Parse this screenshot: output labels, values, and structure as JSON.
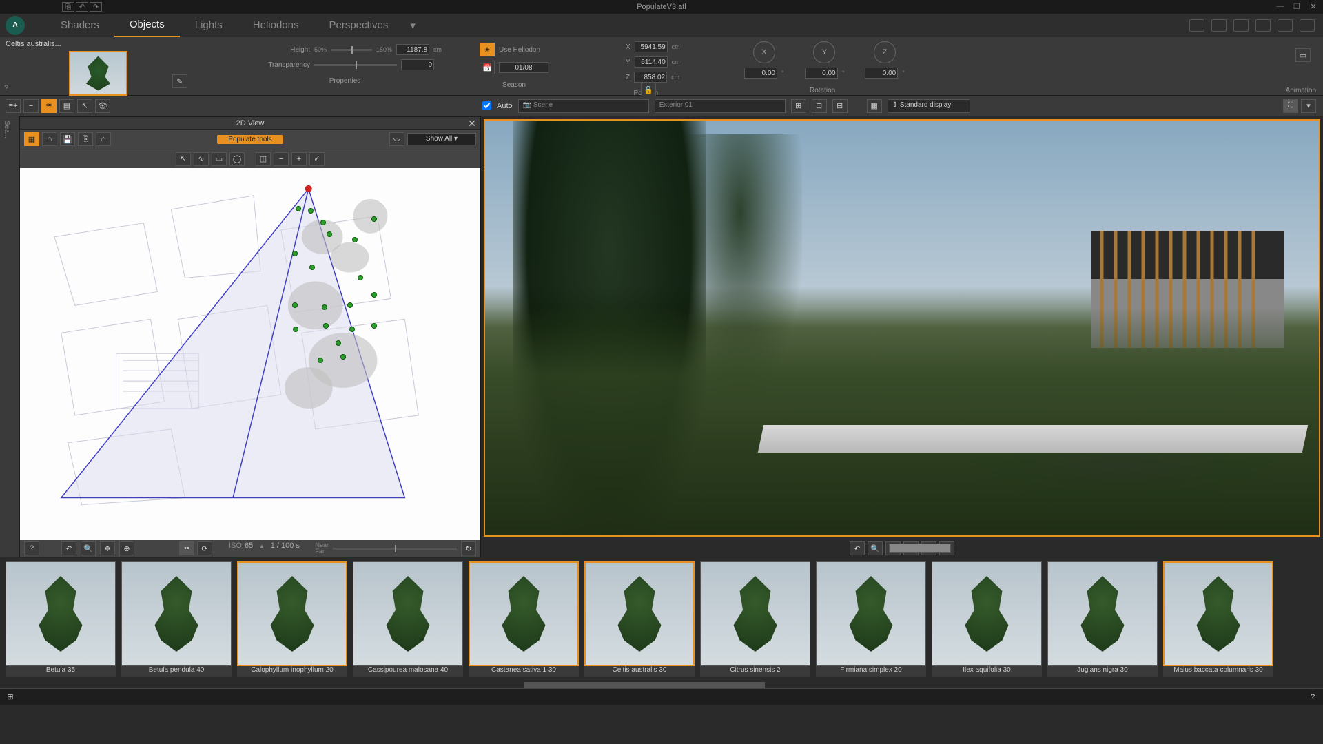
{
  "titlebar": {
    "filename": "PopulateV3.atl"
  },
  "menubar": {
    "items": [
      "Shaders",
      "Objects",
      "Lights",
      "Heliodons",
      "Perspectives"
    ],
    "active": 1
  },
  "thumbnail": {
    "label": "Celtis australis..."
  },
  "properties": {
    "height_label": "Height",
    "height_min": "50%",
    "height_max": "150%",
    "height_value": "1187.8",
    "height_unit": "cm",
    "transparency_label": "Transparency",
    "transparency_value": "0",
    "section_label": "Properties"
  },
  "season": {
    "use_heliodon": "Use Heliodon",
    "date": "01/08",
    "section_label": "Season"
  },
  "position": {
    "x_label": "X",
    "x_value": "5941.59",
    "x_unit": "cm",
    "y_label": "Y",
    "y_value": "6114.40",
    "y_unit": "cm",
    "z_label": "Z",
    "z_value": "858.02",
    "z_unit": "cm",
    "section_label": "Position"
  },
  "rotation": {
    "axes": [
      "X",
      "Y",
      "Z"
    ],
    "values": [
      "0.00",
      "0.00",
      "0.00"
    ],
    "unit": "°",
    "section_label": "Rotation"
  },
  "animation_label": "Animation",
  "toolbar": {
    "auto": "Auto",
    "scene_dd": "Scene",
    "view_dd": "Exterior 01",
    "display_mode": "Standard display"
  },
  "view2d": {
    "title": "2D View",
    "populate_label": "Populate tools",
    "showall": "Show All",
    "near": "Near",
    "far": "Far",
    "help": "?"
  },
  "render_controls": {
    "iso_label": "ISO",
    "iso_value": "65",
    "frame_label": "1 / 100 s"
  },
  "catalog": {
    "items": [
      {
        "label": "Betula 35",
        "selected": false
      },
      {
        "label": "Betula pendula 40",
        "selected": false
      },
      {
        "label": "Calophyllum inophyllum 20",
        "selected": true
      },
      {
        "label": "Cassipourea malosana 40",
        "selected": false
      },
      {
        "label": "Castanea sativa 1 30",
        "selected": true
      },
      {
        "label": "Celtis australis 30",
        "selected": true
      },
      {
        "label": "Citrus sinensis 2",
        "selected": false
      },
      {
        "label": "Firmiana simplex 20",
        "selected": false
      },
      {
        "label": "Ilex aquifolia 30",
        "selected": false
      },
      {
        "label": "Juglans nigra 30",
        "selected": false
      },
      {
        "label": "Malus baccata columnaris 30",
        "selected": true
      }
    ]
  }
}
